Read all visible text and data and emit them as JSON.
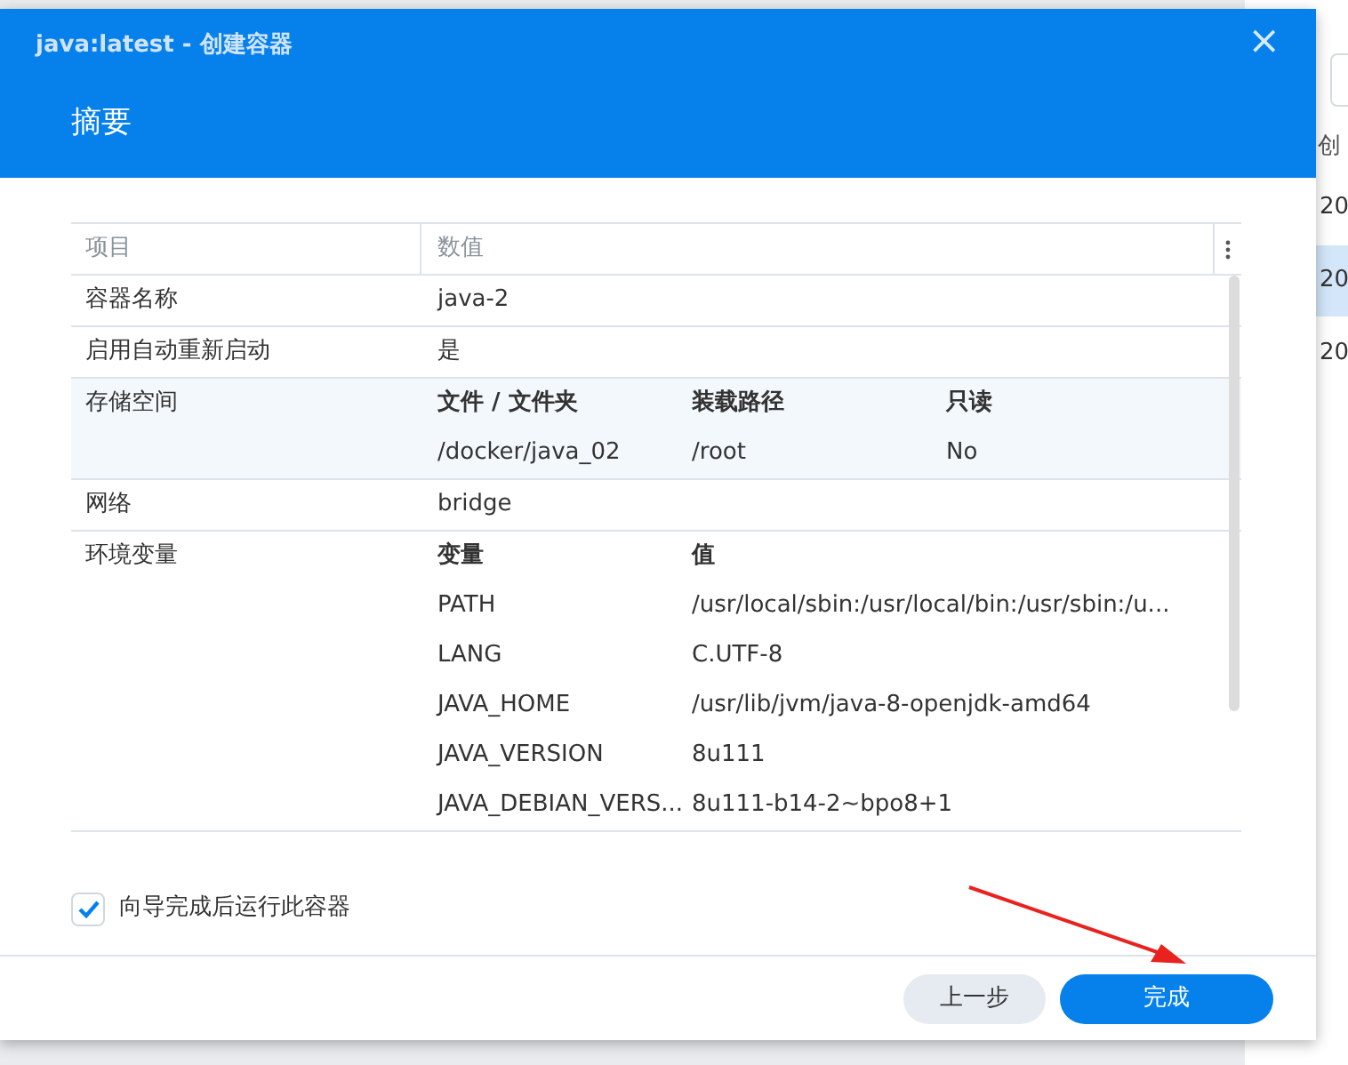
{
  "background_page": {
    "column_heading": "创",
    "cells": [
      {
        "text": "20",
        "selected": false
      },
      {
        "text": "20",
        "selected": true
      },
      {
        "text": "20",
        "selected": false
      }
    ]
  },
  "dialog": {
    "title": "java:latest - 创建容器",
    "heading": "摘要",
    "close_label": "×",
    "table": {
      "columns": [
        "项目",
        "数值"
      ],
      "rows": [
        {
          "kind": "simple",
          "label": "容器名称",
          "value": "java-2",
          "selected": false
        },
        {
          "kind": "simple",
          "label": "启用自动重新启动",
          "value": "是",
          "selected": false
        },
        {
          "kind": "subtable",
          "label": "存储空间",
          "selected": true,
          "columns": [
            "文件 / 文件夹",
            "装载路径",
            "只读"
          ],
          "rows": [
            [
              "/docker/java_02",
              "/root",
              "No"
            ]
          ]
        },
        {
          "kind": "simple",
          "label": "网络",
          "value": "bridge",
          "selected": false
        },
        {
          "kind": "subtable",
          "label": "环境变量",
          "selected": false,
          "columns": [
            "变量",
            "值"
          ],
          "rows": [
            [
              "PATH",
              "/usr/local/sbin:/usr/local/bin:/usr/sbin:/u..."
            ],
            [
              "LANG",
              "C.UTF-8"
            ],
            [
              "JAVA_HOME",
              "/usr/lib/jvm/java-8-openjdk-amd64"
            ],
            [
              "JAVA_VERSION",
              "8u111"
            ],
            [
              "JAVA_DEBIAN_VERS...",
              "8u111-b14-2~bpo8+1"
            ]
          ]
        }
      ]
    },
    "run_after": {
      "label": "向导完成后运行此容器",
      "checked": true
    },
    "buttons": [
      {
        "label": "上一步",
        "kind": "secondary"
      },
      {
        "label": "完成",
        "kind": "primary"
      }
    ]
  }
}
